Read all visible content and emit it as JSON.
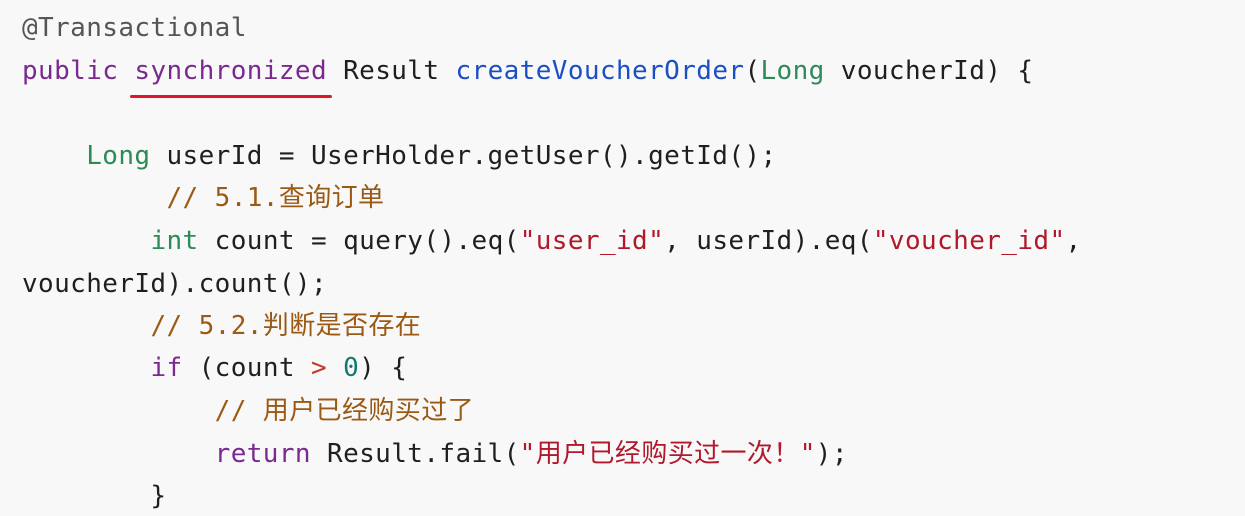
{
  "code": {
    "lines": [
      {
        "tokens": [
          {
            "t": "annotation",
            "v": "@Transactional"
          }
        ]
      },
      {
        "tokens": [
          {
            "t": "modifier",
            "v": "public"
          },
          {
            "t": "plain",
            "v": " "
          },
          {
            "t": "modifier",
            "v": "synchronized"
          },
          {
            "t": "plain",
            "v": " Result "
          },
          {
            "t": "func",
            "v": "createVoucherOrder"
          },
          {
            "t": "plain",
            "v": "("
          },
          {
            "t": "type",
            "v": "Long"
          },
          {
            "t": "plain",
            "v": " voucherId) {"
          }
        ]
      },
      {
        "tokens": [
          {
            "t": "plain",
            "v": ""
          }
        ]
      },
      {
        "tokens": [
          {
            "t": "plain",
            "v": "    "
          },
          {
            "t": "type",
            "v": "Long"
          },
          {
            "t": "plain",
            "v": " userId = UserHolder.getUser().getId();"
          }
        ]
      },
      {
        "tokens": [
          {
            "t": "plain",
            "v": "         "
          },
          {
            "t": "comment",
            "v": "// 5.1.查询订单"
          }
        ]
      },
      {
        "tokens": [
          {
            "t": "plain",
            "v": "        "
          },
          {
            "t": "type",
            "v": "int"
          },
          {
            "t": "plain",
            "v": " count = query().eq("
          },
          {
            "t": "string",
            "v": "\"user_id\""
          },
          {
            "t": "plain",
            "v": ", userId).eq("
          },
          {
            "t": "string",
            "v": "\"voucher_id\""
          },
          {
            "t": "plain",
            "v": ","
          }
        ]
      },
      {
        "tokens": [
          {
            "t": "plain",
            "v": "voucherId).count();"
          }
        ]
      },
      {
        "tokens": [
          {
            "t": "plain",
            "v": "        "
          },
          {
            "t": "comment",
            "v": "// 5.2.判断是否存在"
          }
        ]
      },
      {
        "tokens": [
          {
            "t": "plain",
            "v": "        "
          },
          {
            "t": "keyword",
            "v": "if"
          },
          {
            "t": "plain",
            "v": " (count "
          },
          {
            "t": "op",
            "v": ">"
          },
          {
            "t": "plain",
            "v": " "
          },
          {
            "t": "number",
            "v": "0"
          },
          {
            "t": "plain",
            "v": ") {"
          }
        ]
      },
      {
        "tokens": [
          {
            "t": "plain",
            "v": "            "
          },
          {
            "t": "comment",
            "v": "// 用户已经购买过了"
          }
        ]
      },
      {
        "tokens": [
          {
            "t": "plain",
            "v": "            "
          },
          {
            "t": "keyword",
            "v": "return"
          },
          {
            "t": "plain",
            "v": " Result.fail("
          },
          {
            "t": "string",
            "v": "\"用户已经购买过一次！\""
          },
          {
            "t": "plain",
            "v": ");"
          }
        ]
      },
      {
        "tokens": [
          {
            "t": "plain",
            "v": "        }"
          }
        ]
      }
    ]
  },
  "colors": {
    "background": "#f8f8f8",
    "highlight_underline": "#e0162b"
  }
}
